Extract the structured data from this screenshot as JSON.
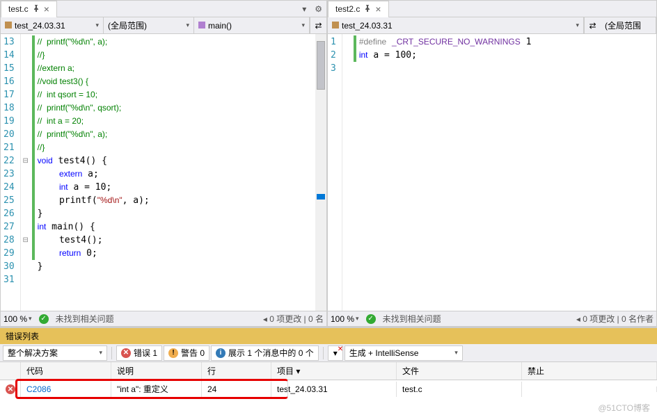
{
  "left": {
    "tab": "test.c",
    "nav_file": "test_24.03.31",
    "nav_scope": "(全局范围)",
    "nav_func": "main()",
    "zoom": "100 %",
    "status": "未找到相关问题",
    "changes": "0  项更改 | 0  名",
    "lines": [
      {
        "n": 13,
        "bar": true,
        "html": "<span class='cmt'>//  printf(\"%d\\n\", a);</span>"
      },
      {
        "n": 14,
        "bar": true,
        "html": "<span class='cmt'>//}</span>"
      },
      {
        "n": 15,
        "bar": true,
        "html": "<span class='cmt'>//extern a;</span>"
      },
      {
        "n": 16,
        "bar": true,
        "html": "<span class='cmt'>//void test3() {</span>"
      },
      {
        "n": 17,
        "bar": true,
        "html": "<span class='cmt'>//  int qsort = 10;</span>"
      },
      {
        "n": 18,
        "bar": true,
        "html": "<span class='cmt'>//  printf(\"%d\\n\", qsort);</span>"
      },
      {
        "n": 19,
        "bar": true,
        "html": "<span class='cmt'>//  int a = 20;</span>"
      },
      {
        "n": 20,
        "bar": true,
        "html": "<span class='cmt'>//  printf(\"%d\\n\", a);</span>"
      },
      {
        "n": 21,
        "bar": true,
        "html": "<span class='cmt'>//}</span>"
      },
      {
        "n": 22,
        "bar": true,
        "fold": "⊟",
        "html": "<span class='kw'>void</span> test4() {"
      },
      {
        "n": 23,
        "bar": true,
        "html": "    <span class='kw'>extern</span> a;"
      },
      {
        "n": 24,
        "bar": true,
        "html": "    <span class='kw'>int</span> a = 10;"
      },
      {
        "n": 25,
        "bar": true,
        "html": "    printf(<span class='str'>\"%d\\n\"</span>, a);"
      },
      {
        "n": 26,
        "bar": true,
        "html": "}"
      },
      {
        "n": 27,
        "bar": true,
        "html": ""
      },
      {
        "n": 28,
        "bar": true,
        "fold": "⊟",
        "html": "<span class='kw'>int</span> main() {"
      },
      {
        "n": 29,
        "bar": true,
        "html": "    test4();"
      },
      {
        "n": 30,
        "bar": true,
        "html": "    <span class='kw'>return</span> 0;"
      },
      {
        "n": 31,
        "bar": false,
        "html": "}"
      }
    ]
  },
  "right": {
    "tab": "test2.c",
    "nav_file": "test_24.03.31",
    "nav_scope": "(全局范围",
    "zoom": "100 %",
    "status": "未找到相关问题",
    "changes": "0  项更改 | 0  名作者",
    "lines": [
      {
        "n": 1,
        "bar": true,
        "html": "<span class='pp'>#define</span> <span class='macroid'>_CRT_SECURE_NO_WARNINGS</span> 1"
      },
      {
        "n": 2,
        "bar": true,
        "html": ""
      },
      {
        "n": 3,
        "bar": true,
        "html": "<span class='kw'>int</span> a = 100;"
      }
    ]
  },
  "err": {
    "title": "错误列表",
    "dd_solution": "整个解决方案",
    "errors_btn": "错误 1",
    "warnings_btn": "警告 0",
    "messages_btn": "展示 1 个消息中的 0 个",
    "build_filter": "生成 + IntelliSense",
    "headers": {
      "code": "代码",
      "desc": "说明",
      "line": "行",
      "proj": "项目",
      "file": "文件",
      "forbid": "禁止"
    },
    "row": {
      "code": "C2086",
      "desc": "\"int a\": 重定义",
      "line": "24",
      "proj": "test_24.03.31",
      "file": "test.c"
    }
  },
  "watermark": "@51CTO博客"
}
